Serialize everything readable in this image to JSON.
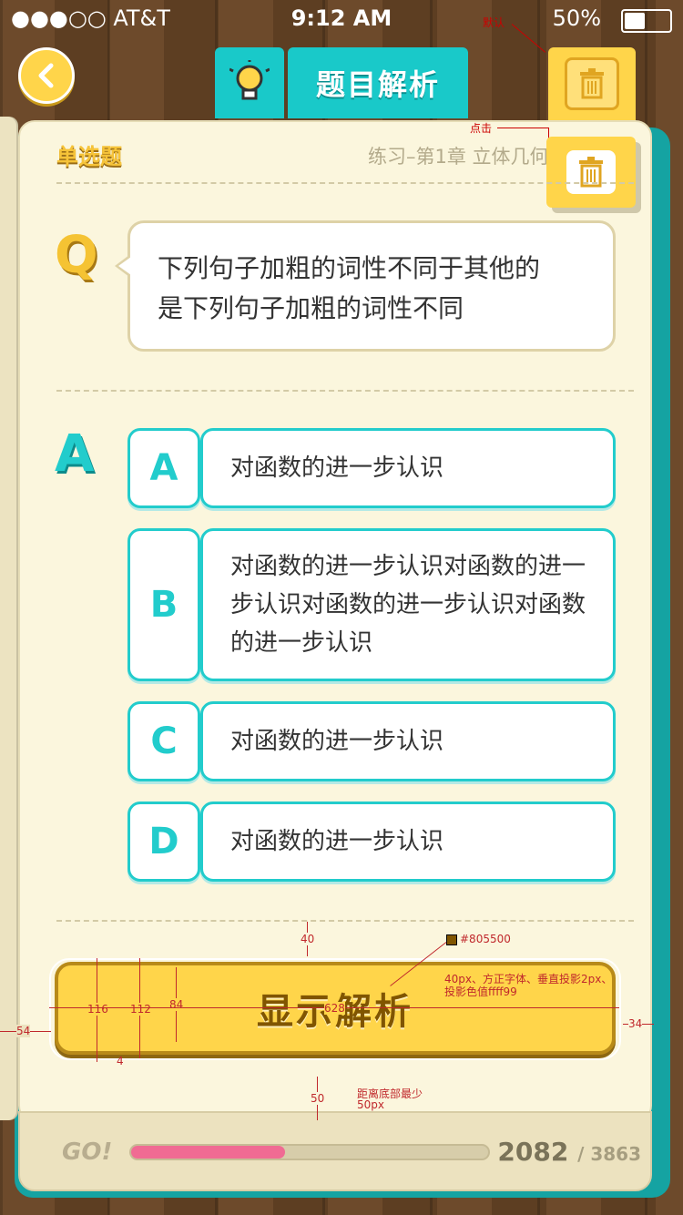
{
  "status_bar": {
    "carrier": "●●●○○ AT&T",
    "time": "9:12 AM",
    "battery_pct": "50%",
    "battery_fraction": 0.5
  },
  "header": {
    "title": "题目解析"
  },
  "notes": {
    "default": "默认",
    "click": "点击"
  },
  "question": {
    "type": "单选题",
    "chapter": "练习–第1章 立体几何",
    "q_letter": "Q",
    "text_line1": "下列句子加粗的词性不同于其他的",
    "text_line2": "是下列句子加粗的词性不同"
  },
  "answers": {
    "a_letter": "A",
    "options": [
      {
        "letter": "A",
        "text": "对函数的进一步认识"
      },
      {
        "letter": "B",
        "text": "对函数的进一步认识对函数的进一步认识对函数的进一步认识对函数的进一步认识"
      },
      {
        "letter": "C",
        "text": "对函数的进一步认识"
      },
      {
        "letter": "D",
        "text": "对函数的进一步认识"
      }
    ]
  },
  "button": {
    "label": "显示解析"
  },
  "annotations": {
    "gap_40": "40",
    "color": "#805500",
    "font_spec_line1": "40px、方正字体、垂直投影2px、",
    "font_spec_line2": "投影色值ffff99",
    "h_116": "116",
    "h_112": "112",
    "h_84": "84",
    "w_628": "628",
    "m_54": "54",
    "m_34": "34",
    "m_4": "4",
    "gap_50": "50",
    "bottom_line1": "距离底部最少",
    "bottom_line2": "50px"
  },
  "footer": {
    "go": "GO!",
    "progress_fraction": 0.43,
    "current": "2082",
    "total": "/ 3863"
  },
  "colors": {
    "teal": "#22cccc",
    "yellow": "#ffd54a",
    "text_brown": "#805500",
    "progress": "#f06b93"
  }
}
